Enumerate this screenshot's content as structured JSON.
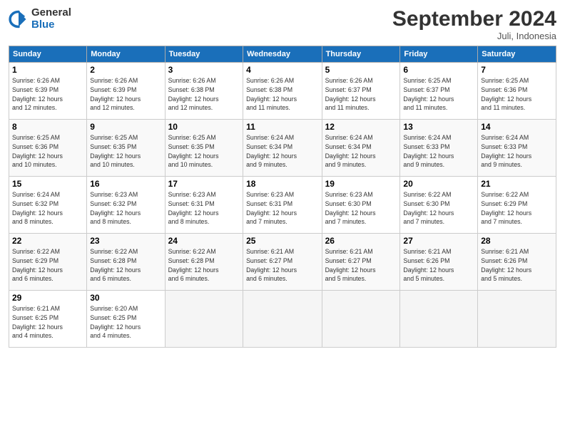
{
  "logo": {
    "general": "General",
    "blue": "Blue"
  },
  "title": "September 2024",
  "subtitle": "Juli, Indonesia",
  "headers": [
    "Sunday",
    "Monday",
    "Tuesday",
    "Wednesday",
    "Thursday",
    "Friday",
    "Saturday"
  ],
  "weeks": [
    [
      {
        "day": "1",
        "info": "Sunrise: 6:26 AM\nSunset: 6:39 PM\nDaylight: 12 hours\nand 12 minutes."
      },
      {
        "day": "2",
        "info": "Sunrise: 6:26 AM\nSunset: 6:39 PM\nDaylight: 12 hours\nand 12 minutes."
      },
      {
        "day": "3",
        "info": "Sunrise: 6:26 AM\nSunset: 6:38 PM\nDaylight: 12 hours\nand 12 minutes."
      },
      {
        "day": "4",
        "info": "Sunrise: 6:26 AM\nSunset: 6:38 PM\nDaylight: 12 hours\nand 11 minutes."
      },
      {
        "day": "5",
        "info": "Sunrise: 6:26 AM\nSunset: 6:37 PM\nDaylight: 12 hours\nand 11 minutes."
      },
      {
        "day": "6",
        "info": "Sunrise: 6:25 AM\nSunset: 6:37 PM\nDaylight: 12 hours\nand 11 minutes."
      },
      {
        "day": "7",
        "info": "Sunrise: 6:25 AM\nSunset: 6:36 PM\nDaylight: 12 hours\nand 11 minutes."
      }
    ],
    [
      {
        "day": "8",
        "info": "Sunrise: 6:25 AM\nSunset: 6:36 PM\nDaylight: 12 hours\nand 10 minutes."
      },
      {
        "day": "9",
        "info": "Sunrise: 6:25 AM\nSunset: 6:35 PM\nDaylight: 12 hours\nand 10 minutes."
      },
      {
        "day": "10",
        "info": "Sunrise: 6:25 AM\nSunset: 6:35 PM\nDaylight: 12 hours\nand 10 minutes."
      },
      {
        "day": "11",
        "info": "Sunrise: 6:24 AM\nSunset: 6:34 PM\nDaylight: 12 hours\nand 9 minutes."
      },
      {
        "day": "12",
        "info": "Sunrise: 6:24 AM\nSunset: 6:34 PM\nDaylight: 12 hours\nand 9 minutes."
      },
      {
        "day": "13",
        "info": "Sunrise: 6:24 AM\nSunset: 6:33 PM\nDaylight: 12 hours\nand 9 minutes."
      },
      {
        "day": "14",
        "info": "Sunrise: 6:24 AM\nSunset: 6:33 PM\nDaylight: 12 hours\nand 9 minutes."
      }
    ],
    [
      {
        "day": "15",
        "info": "Sunrise: 6:24 AM\nSunset: 6:32 PM\nDaylight: 12 hours\nand 8 minutes."
      },
      {
        "day": "16",
        "info": "Sunrise: 6:23 AM\nSunset: 6:32 PM\nDaylight: 12 hours\nand 8 minutes."
      },
      {
        "day": "17",
        "info": "Sunrise: 6:23 AM\nSunset: 6:31 PM\nDaylight: 12 hours\nand 8 minutes."
      },
      {
        "day": "18",
        "info": "Sunrise: 6:23 AM\nSunset: 6:31 PM\nDaylight: 12 hours\nand 7 minutes."
      },
      {
        "day": "19",
        "info": "Sunrise: 6:23 AM\nSunset: 6:30 PM\nDaylight: 12 hours\nand 7 minutes."
      },
      {
        "day": "20",
        "info": "Sunrise: 6:22 AM\nSunset: 6:30 PM\nDaylight: 12 hours\nand 7 minutes."
      },
      {
        "day": "21",
        "info": "Sunrise: 6:22 AM\nSunset: 6:29 PM\nDaylight: 12 hours\nand 7 minutes."
      }
    ],
    [
      {
        "day": "22",
        "info": "Sunrise: 6:22 AM\nSunset: 6:29 PM\nDaylight: 12 hours\nand 6 minutes."
      },
      {
        "day": "23",
        "info": "Sunrise: 6:22 AM\nSunset: 6:28 PM\nDaylight: 12 hours\nand 6 minutes."
      },
      {
        "day": "24",
        "info": "Sunrise: 6:22 AM\nSunset: 6:28 PM\nDaylight: 12 hours\nand 6 minutes."
      },
      {
        "day": "25",
        "info": "Sunrise: 6:21 AM\nSunset: 6:27 PM\nDaylight: 12 hours\nand 6 minutes."
      },
      {
        "day": "26",
        "info": "Sunrise: 6:21 AM\nSunset: 6:27 PM\nDaylight: 12 hours\nand 5 minutes."
      },
      {
        "day": "27",
        "info": "Sunrise: 6:21 AM\nSunset: 6:26 PM\nDaylight: 12 hours\nand 5 minutes."
      },
      {
        "day": "28",
        "info": "Sunrise: 6:21 AM\nSunset: 6:26 PM\nDaylight: 12 hours\nand 5 minutes."
      }
    ],
    [
      {
        "day": "29",
        "info": "Sunrise: 6:21 AM\nSunset: 6:25 PM\nDaylight: 12 hours\nand 4 minutes."
      },
      {
        "day": "30",
        "info": "Sunrise: 6:20 AM\nSunset: 6:25 PM\nDaylight: 12 hours\nand 4 minutes."
      },
      null,
      null,
      null,
      null,
      null
    ]
  ]
}
